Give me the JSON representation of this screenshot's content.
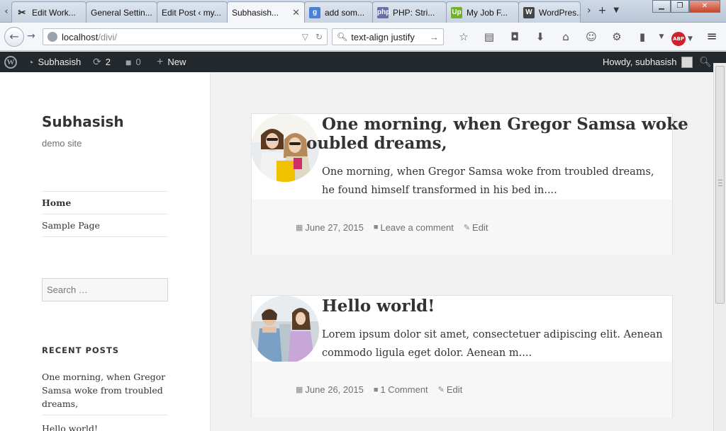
{
  "browser": {
    "tabs": [
      {
        "label": "Edit Work...",
        "icon": "wrench-icon",
        "color": "#555555",
        "glyph": "✂",
        "active": false
      },
      {
        "label": "General Settin...",
        "icon": "blank-page-icon",
        "color": "",
        "glyph": "",
        "active": false
      },
      {
        "label": "Edit Post ‹ my...",
        "icon": "blank-page-icon",
        "color": "",
        "glyph": "",
        "active": false
      },
      {
        "label": "Subhasish...",
        "icon": "blank-page-icon",
        "color": "",
        "glyph": "",
        "active": true
      },
      {
        "label": "add som...",
        "icon": "google-icon",
        "color": "#4a7fd6",
        "glyph": "g",
        "active": false
      },
      {
        "label": "PHP: Stri...",
        "icon": "php-icon",
        "color": "#6a6fa6",
        "glyph": "php",
        "active": false
      },
      {
        "label": "My Job F...",
        "icon": "upwork-icon",
        "color": "#6fb12f",
        "glyph": "Up",
        "active": false
      },
      {
        "label": "WordPres...",
        "icon": "wordpress-icon",
        "color": "#464646",
        "glyph": "W",
        "active": false
      }
    ],
    "url": "localhost",
    "url_path": "/divi/",
    "search_value": "text-align justify"
  },
  "adminbar": {
    "site_name": "Subhasish",
    "updates_count": "2",
    "comments_count": "0",
    "new_label": "New",
    "howdy": "Howdy, subhasish"
  },
  "site": {
    "title": "Subhasish",
    "description": "demo site"
  },
  "nav": {
    "items": [
      {
        "label": "Home",
        "current": true
      },
      {
        "label": "Sample Page",
        "current": false
      }
    ]
  },
  "search": {
    "placeholder": "Search …"
  },
  "widgets": {
    "recent_posts_title": "RECENT POSTS",
    "recent_posts": [
      "One morning, when Gregor Samsa woke from troubled dreams,",
      "Hello world!"
    ]
  },
  "posts": [
    {
      "title_line1": "One morning, when Gregor Samsa woke",
      "title_line2": "oubled dreams,",
      "excerpt": "One morning, when Gregor Samsa woke from troubled dreams, he found himself transformed in his bed in....",
      "date": "June 27, 2015",
      "comments": "Leave a comment",
      "edit": "Edit"
    },
    {
      "title_line1": "Hello world!",
      "title_line2": "",
      "excerpt": "Lorem ipsum dolor sit amet, consectetuer adipiscing elit. Aenean commodo ligula eget dolor. Aenean m....",
      "date": "June 26, 2015",
      "comments": "1 Comment",
      "edit": "Edit"
    }
  ]
}
